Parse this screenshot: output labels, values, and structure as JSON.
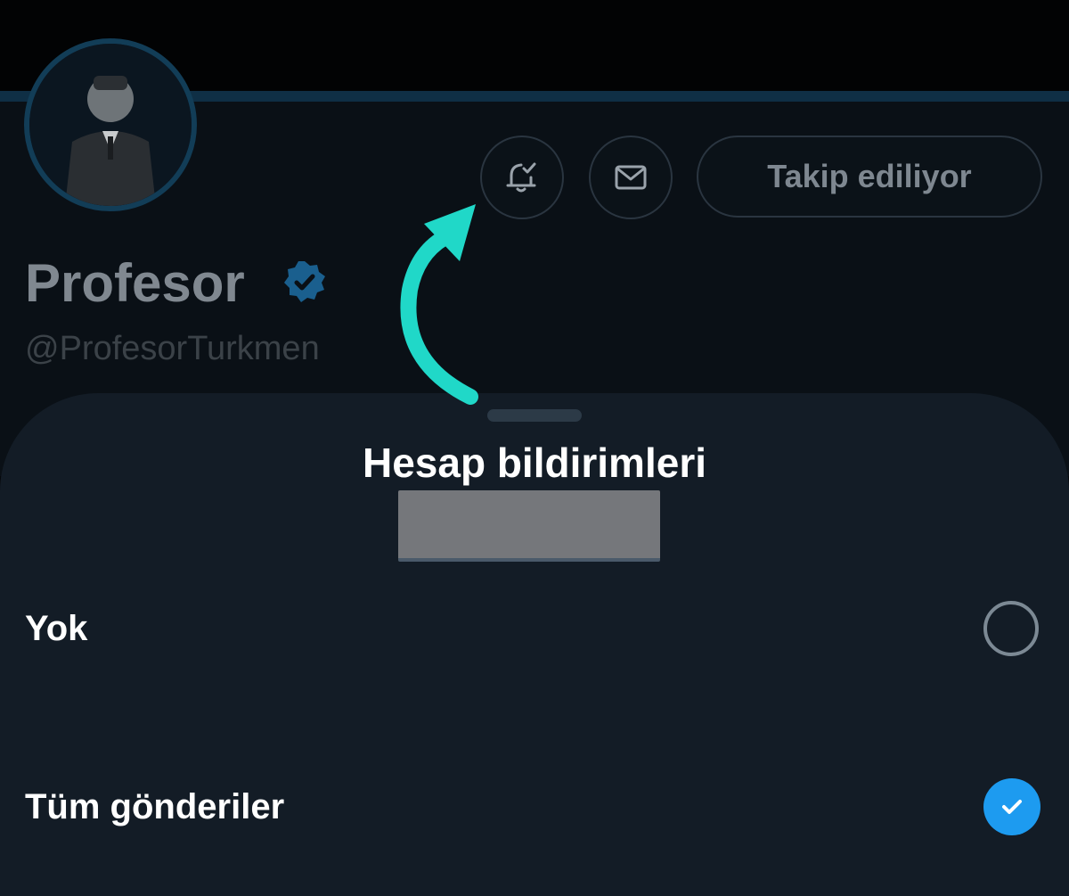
{
  "profile": {
    "display_name": "Profesor",
    "handle": "@ProfesorTurkmen",
    "verified": true,
    "follow_button_label": "Takip ediliyor"
  },
  "icons": {
    "notification_bell": "bell-check-icon",
    "message": "mail-icon",
    "verified_badge": "verified-badge-icon",
    "selected": "check-icon"
  },
  "sheet": {
    "title": "Hesap bildirimleri",
    "options": [
      {
        "label": "Yok",
        "selected": false
      },
      {
        "label": "Tüm gönderiler",
        "selected": true
      }
    ]
  },
  "colors": {
    "accent_blue": "#1d9bf0",
    "annotation_arrow": "#20d8c8",
    "sheet_background": "#131c26",
    "redaction_box": "#75777b"
  }
}
